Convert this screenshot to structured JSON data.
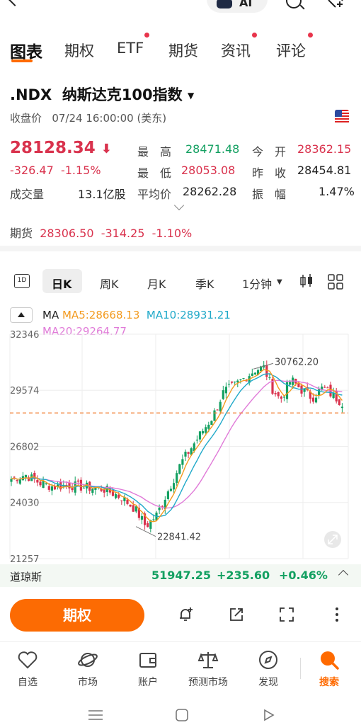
{
  "header": {
    "ai_label": "AI"
  },
  "tabs": [
    {
      "label": "图表",
      "active": true
    },
    {
      "label": "期权"
    },
    {
      "label": "ETF",
      "dot": true
    },
    {
      "label": "期货"
    },
    {
      "label": "资讯",
      "dot": true
    },
    {
      "label": "评论",
      "dot": true
    }
  ],
  "quote": {
    "symbol": ".NDX",
    "name": "纳斯达克100指数",
    "status_label": "收盘价",
    "time": "07/24 16:00:00 (美东)",
    "price": "28128.34",
    "change": "-326.47",
    "change_pct": "-1.15%",
    "volume_label": "成交量",
    "volume": "13.1亿股",
    "high_label": "最　高",
    "high": "28471.48",
    "low_label": "最　低",
    "low": "28053.08",
    "avg_label": "平均价",
    "avg": "28262.28",
    "open_label": "今　开",
    "open": "28362.15",
    "prev_label": "昨　收",
    "prev": "28454.81",
    "amp_label": "振　幅",
    "amp": "1.47%"
  },
  "futures": {
    "label": "期货",
    "price": "28306.50",
    "change": "-314.25",
    "change_pct": "-1.10%"
  },
  "period_bar": {
    "items": [
      "日K",
      "周K",
      "月K",
      "季K",
      "1分钟"
    ],
    "active": "日K",
    "icon_1d": "1D"
  },
  "ma": {
    "label": "MA",
    "ma5": "MA5:28668.13",
    "ma10": "MA10:28931.21",
    "ma20": "MA20:29264.77",
    "colors": {
      "ma5": "#f39a1e",
      "ma10": "#20a9c9",
      "ma20": "#e07ad8"
    }
  },
  "chart_data": {
    "type": "candlestick",
    "y_ticks": [
      "32346",
      "29574",
      "26802",
      "24030",
      "21257"
    ],
    "ylim": [
      21257,
      32346
    ],
    "reference_line": 28454.81,
    "annotations": [
      {
        "label": "30762.20",
        "value": 30762.2,
        "kind": "high"
      },
      {
        "label": "22841.42",
        "value": 22841.42,
        "kind": "low"
      }
    ],
    "colors": {
      "up": "#13a061",
      "down": "#d9324d",
      "ref": "#f07a2a"
    }
  },
  "index_bar": {
    "name": "道琼斯",
    "value": "51947.25",
    "change": "+235.60",
    "change_pct": "+0.46%"
  },
  "action_bar": {
    "primary_label": "期权"
  },
  "tabbar": [
    {
      "label": "自选",
      "icon": "heart-icon"
    },
    {
      "label": "市场",
      "icon": "planet-icon"
    },
    {
      "label": "账户",
      "icon": "wallet-icon"
    },
    {
      "label": "预测市场",
      "icon": "scale-icon"
    },
    {
      "label": "发现",
      "icon": "compass-icon"
    },
    {
      "label": "搜索",
      "icon": "search-icon",
      "active": true
    }
  ]
}
